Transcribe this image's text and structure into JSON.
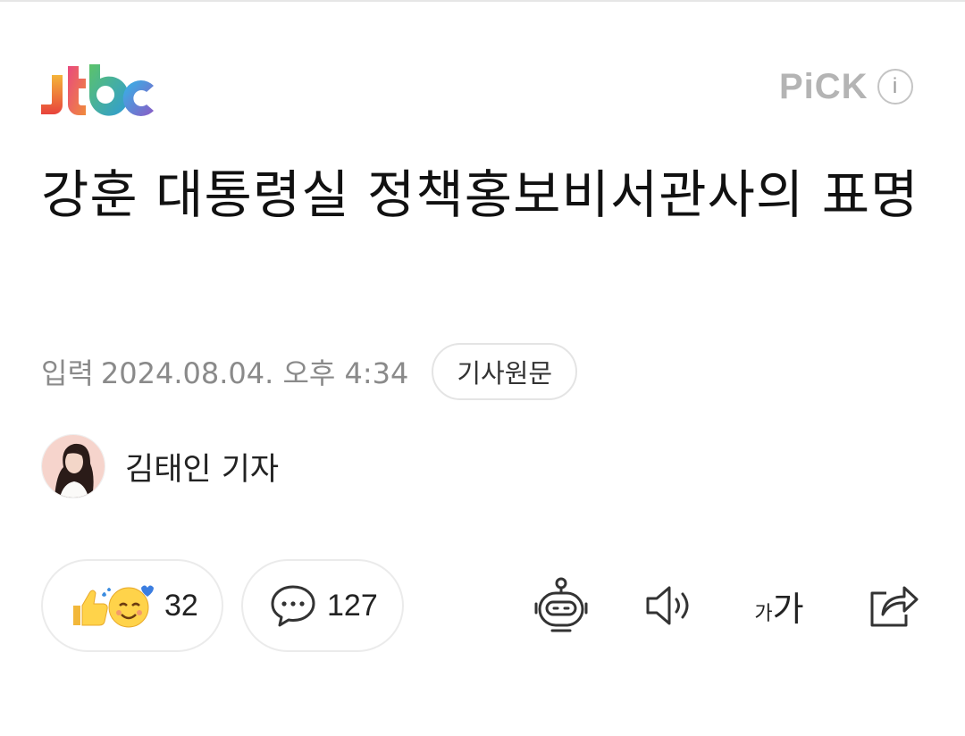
{
  "header": {
    "logo_icon": "jtbc-logo",
    "pick_label": "PiCK",
    "info_icon_text": "i"
  },
  "article": {
    "title": "강훈 대통령실 정책홍보비서관사의 표명",
    "input_label": "입력",
    "datetime": "2024.08.04. 오후 4:34",
    "source_button": "기사원문"
  },
  "author": {
    "name": "김태인 기자",
    "avatar_icon": "reporter-avatar"
  },
  "actions": {
    "reaction_count": "32",
    "comment_count": "127",
    "font_small": "가",
    "font_big": "가"
  },
  "colors": {
    "text": "#111111",
    "meta": "#8a8a8a",
    "border": "#ebebeb",
    "pick": "#b4b4b4"
  }
}
